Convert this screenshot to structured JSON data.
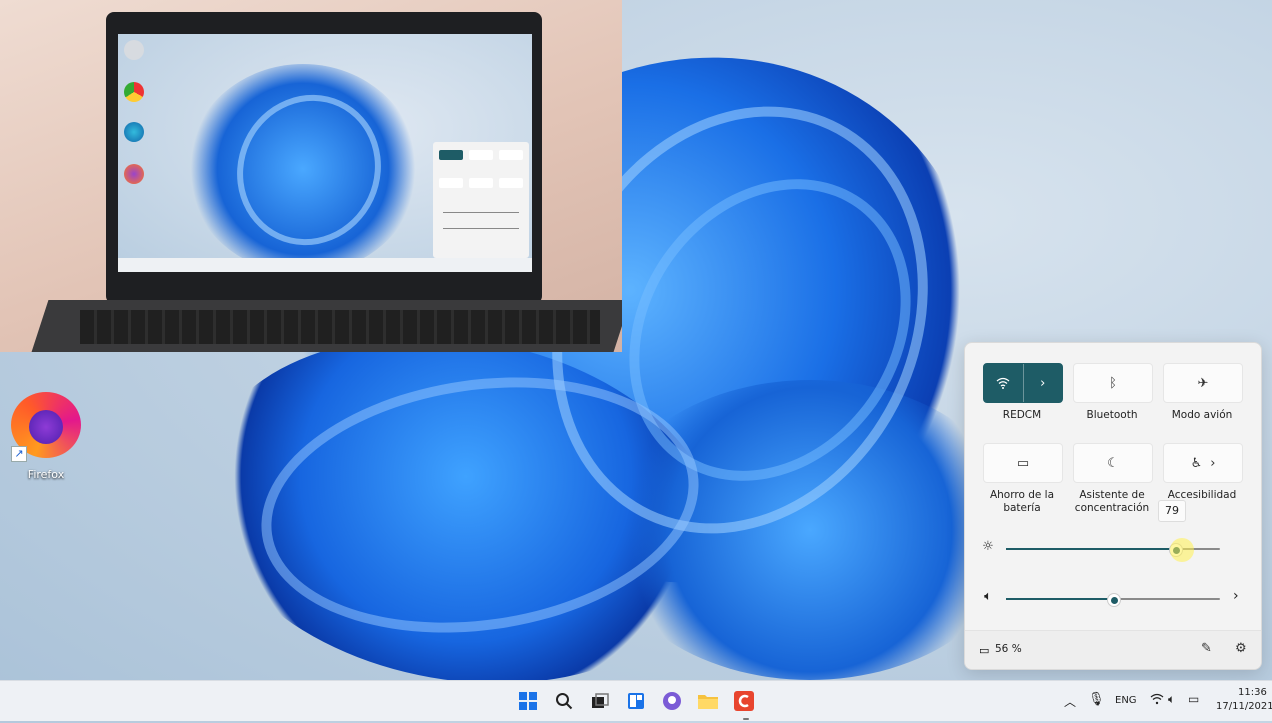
{
  "desktop": {
    "icons": [
      {
        "label": "Firefox",
        "icon": "firefox-icon"
      }
    ]
  },
  "quick_settings": {
    "tiles": [
      {
        "label": "REDCM",
        "icon": "wifi-icon",
        "active": true,
        "has_chevron": true
      },
      {
        "label": "Bluetooth",
        "icon": "bluetooth-icon",
        "active": false
      },
      {
        "label": "Modo avión",
        "icon": "airplane-icon",
        "active": false
      },
      {
        "label": "Ahorro de la batería",
        "icon": "battery-saver-icon",
        "active": false
      },
      {
        "label": "Asistente de concentración",
        "icon": "moon-icon",
        "active": false
      },
      {
        "label": "Accesibilidad",
        "icon": "accessibility-icon",
        "active": false,
        "has_chevron": true
      }
    ],
    "brightness": {
      "value": 79,
      "tooltip": "79"
    },
    "volume": {
      "value": 50
    },
    "battery": "56 %",
    "accent_color": "#1e5c66"
  },
  "taskbar": {
    "apps": [
      "start-icon",
      "search-icon",
      "task-view-icon",
      "widgets-icon",
      "chat-icon",
      "file-explorer-icon",
      "app-icon"
    ],
    "tray": {
      "language": "ENG",
      "time": "11:36",
      "date": "17/11/2021"
    }
  }
}
